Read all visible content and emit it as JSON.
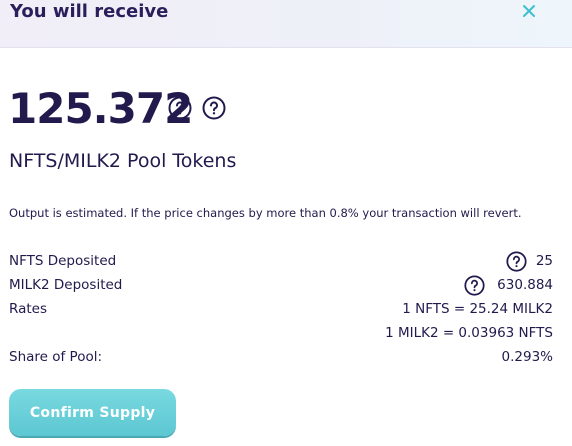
{
  "header": {
    "title": "You will receive"
  },
  "receive": {
    "amount": "125.372",
    "pool_token_label": "NFTS/MILK2 Pool Tokens",
    "estimate_note": "Output is estimated. If the price changes by more than 0.8% your transaction will revert."
  },
  "details": {
    "nfts_deposited": {
      "label": "NFTS Deposited",
      "value": "25"
    },
    "milk2_deposited": {
      "label": "MILK2 Deposited",
      "value": "630.884"
    },
    "rates": {
      "label": "Rates",
      "value_1": "1 NFTS = 25.24 MILK2",
      "value_2": "1 MILK2 = 0.03963 NFTS"
    },
    "share": {
      "label": "Share of Pool:",
      "value": "0.293%"
    }
  },
  "actions": {
    "confirm_label": "Confirm Supply"
  },
  "colors": {
    "accent": "#5cc7d2",
    "text": "#221a4d",
    "close": "#3dbfd0"
  },
  "icons": [
    "close-icon",
    "help-circle-icon"
  ]
}
